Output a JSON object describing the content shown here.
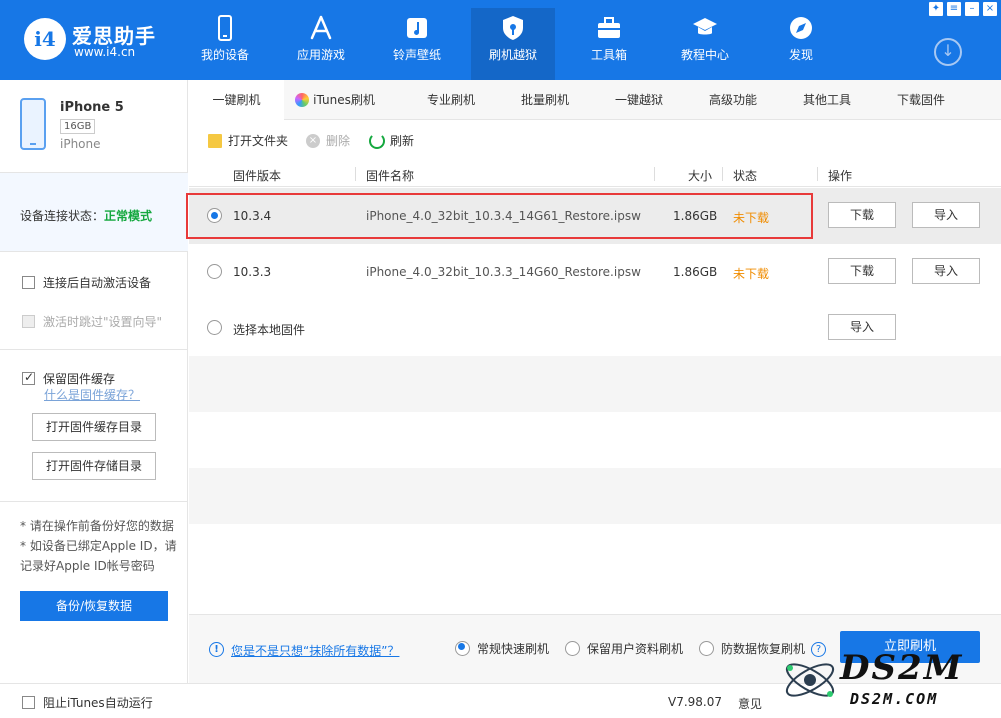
{
  "brand": {
    "name": "爱思助手",
    "url": "www.i4.cn",
    "logo": "i4"
  },
  "nav": [
    {
      "label": "我的设备",
      "icon": "phone-icon"
    },
    {
      "label": "应用游戏",
      "icon": "app-store-icon"
    },
    {
      "label": "铃声壁纸",
      "icon": "music-icon"
    },
    {
      "label": "刷机越狱",
      "icon": "shield-key-icon",
      "active": true
    },
    {
      "label": "工具箱",
      "icon": "toolbox-icon"
    },
    {
      "label": "教程中心",
      "icon": "graduation-cap-icon"
    },
    {
      "label": "发现",
      "icon": "compass-icon"
    }
  ],
  "window_buttons": [
    "shirt-icon",
    "menu-icon",
    "minimize-icon",
    "close-icon"
  ],
  "download_symbol": "↓",
  "device": {
    "name": "iPhone 5",
    "capacity": "16GB",
    "model": "iPhone"
  },
  "connection": {
    "label": "设备连接状态：",
    "value": "正常模式"
  },
  "left_options": {
    "auto_activate": "连接后自动激活设备",
    "skip_guide": "激活时跳过\"设置向导\"",
    "keep_cache": "保留固件缓存",
    "what_is_cache": "什么是固件缓存？",
    "open_cache_dir": "打开固件缓存目录",
    "open_storage_dir": "打开固件存储目录"
  },
  "notes": [
    "* 请在操作前备份好您的数据",
    "* 如设备已绑定Apple ID，请记录好Apple ID帐号密码"
  ],
  "backup_button": "备份/恢复数据",
  "tabs": [
    "一键刷机",
    "iTunes刷机",
    "专业刷机",
    "批量刷机",
    "一键越狱",
    "高级功能",
    "其他工具",
    "下载固件"
  ],
  "toolbar": {
    "open_folder": "打开文件夹",
    "delete": "删除",
    "refresh": "刷新"
  },
  "table": {
    "headers": {
      "version": "固件版本",
      "name": "固件名称",
      "size": "大小",
      "status": "状态",
      "action": "操作"
    },
    "rows": [
      {
        "version": "10.3.4",
        "name": "iPhone_4.0_32bit_10.3.4_14G61_Restore.ipsw",
        "size": "1.86GB",
        "status": "未下载",
        "download": "下载",
        "import": "导入",
        "selected": true
      },
      {
        "version": "10.3.3",
        "name": "iPhone_4.0_32bit_10.3.3_14G60_Restore.ipsw",
        "size": "1.86GB",
        "status": "未下载",
        "download": "下载",
        "import": "导入",
        "selected": false
      }
    ],
    "local": {
      "label": "选择本地固件",
      "import": "导入"
    }
  },
  "footer": {
    "info_symbol": "!",
    "link": "您是不是只想“抹除所有数据”？",
    "options": [
      "常规快速刷机",
      "保留用户资料刷机",
      "防数据恢复刷机"
    ],
    "help_symbol": "?",
    "flash_button": "立即刷机"
  },
  "statusbar": {
    "block_itunes": "阻止iTunes自动运行",
    "version": "V7.98.07",
    "feedback": "意见"
  },
  "watermark": {
    "text": "DS2M",
    "sub": "DS2M.COM"
  },
  "colors": {
    "brand_blue": "#1777e6",
    "status_orange": "#f08c00",
    "ok_green": "#15a83f",
    "highlight_red": "#e83a3a"
  }
}
